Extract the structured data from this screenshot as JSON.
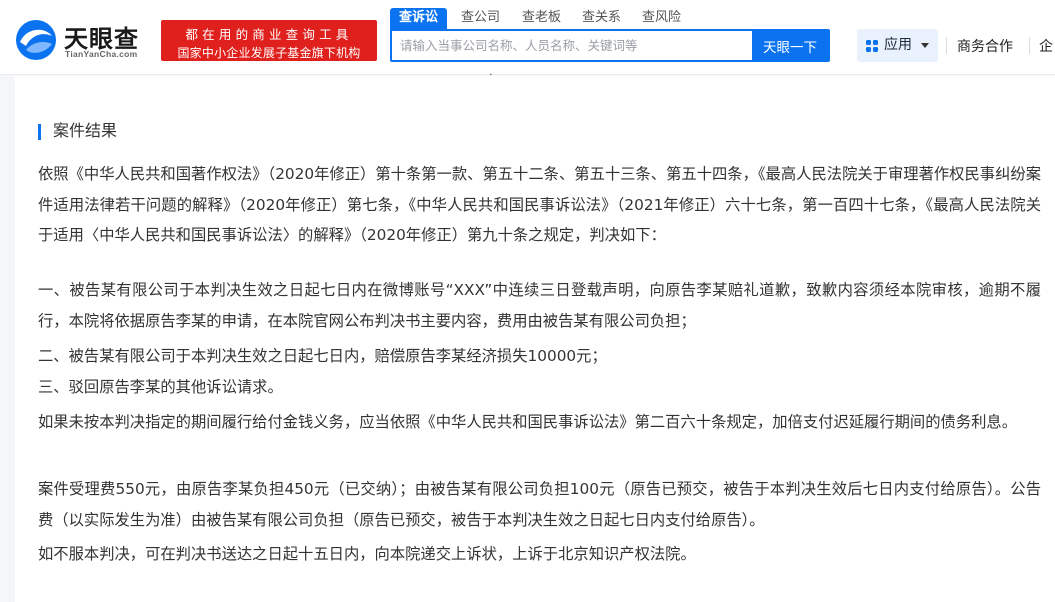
{
  "header": {
    "logo_text": "天眼查",
    "logo_sub": "TianYanCha.com",
    "slogan_line1": "都在用的商业查询工具",
    "slogan_line2": "国家中小企业发展子基金旗下机构",
    "search_tabs": [
      "查诉讼",
      "查公司",
      "查老板",
      "查关系",
      "查风险"
    ],
    "search_placeholder": "请输入当事公司名称、人员名称、关键词等",
    "search_button": "天眼一下",
    "apps_label": "应用",
    "nav_links": [
      "商务合作",
      "企"
    ]
  },
  "content": {
    "section_title": "案件结果",
    "paragraphs": [
      "依照《中华人民共和国著作权法》（2020年修正）第十条第一款、第五十二条、第五十三条、第五十四条，《最高人民法院关于审理著作权民事纠纷案件适用法律若干问题的解释》（2020年修正）第七条，《中华人民共和国民事诉讼法》（2021年修正）六十七条，第一百四十七条，《最高人民法院关于适用〈中华人民共和国民事诉讼法〉的解释》（2020年修正）第九十条之规定，判决如下：",
      "一、被告某有限公司于本判决生效之日起七日内在微博账号“XXX”中连续三日登载声明，向原告李某赔礼道歉，致歉内容须经本院审核，逾期不履行，本院将依据原告李某的申请，在本院官网公布判决书主要内容，费用由被告某有限公司负担；",
      "二、被告某有限公司于本判决生效之日起七日内，赔偿原告李某经济损失10000元；",
      "三、驳回原告李某的其他诉讼请求。",
      "如果未按本判决指定的期间履行给付金钱义务，应当依照《中华人民共和国民事诉讼法》第二百六十条规定，加倍支付迟延履行期间的债务利息。",
      "案件受理费550元，由原告李某负担450元（已交纳）；由被告某有限公司负担100元（原告已预交，被告于本判决生效后七日内支付给原告）。公告费（以实际发生为准）由被告某有限公司负担（原告已预交，被告于本判决生效之日起七日内支付给原告）。",
      "如不服本判决，可在判决书送达之日起十五日内，向本院递交上诉状，上诉于北京知识产权法院。"
    ]
  }
}
